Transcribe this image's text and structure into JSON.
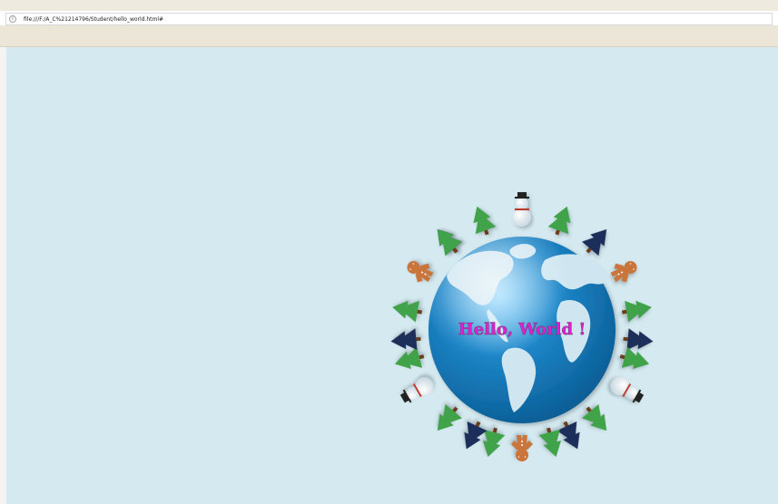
{
  "browser": {
    "url": "file:///F:/A_C%21214796/Student/hello_world.html#"
  },
  "page": {
    "greeting": "Hello, World !",
    "colors": {
      "background": "#d5eaf0",
      "greeting_text": "#e21fd6",
      "ocean": "#1d86c8",
      "land": "#cfe6f1"
    },
    "decorations": {
      "globe": "earth-globe",
      "ring_items": [
        "green-tree",
        "navy-tree",
        "snowman",
        "gingerbread-man"
      ]
    }
  }
}
